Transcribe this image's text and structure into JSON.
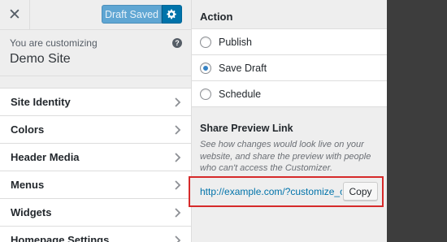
{
  "topbar": {
    "close_glyph": "✕",
    "draft_label": "Draft Saved",
    "gear_icon": "gear-icon"
  },
  "customizing": {
    "lead": "You are customizing",
    "site": "Demo Site",
    "help_glyph": "?"
  },
  "sidebar": {
    "items": [
      {
        "label": "Site Identity"
      },
      {
        "label": "Colors"
      },
      {
        "label": "Header Media"
      },
      {
        "label": "Menus"
      },
      {
        "label": "Widgets"
      },
      {
        "label": "Homepage Settings"
      }
    ]
  },
  "action": {
    "title": "Action",
    "options": [
      {
        "label": "Publish",
        "checked": false
      },
      {
        "label": "Save Draft",
        "checked": true
      },
      {
        "label": "Schedule",
        "checked": false
      }
    ]
  },
  "share": {
    "title": "Share Preview Link",
    "description": "See how changes would look live on your website, and share the preview with people who can't access the Customizer.",
    "link": "http://example.com/?customize_c",
    "copy_label": "Copy"
  },
  "colors": {
    "accent": "#0073aa",
    "highlight_border": "#d62a2a",
    "preview_bg": "#3d3d3d"
  }
}
